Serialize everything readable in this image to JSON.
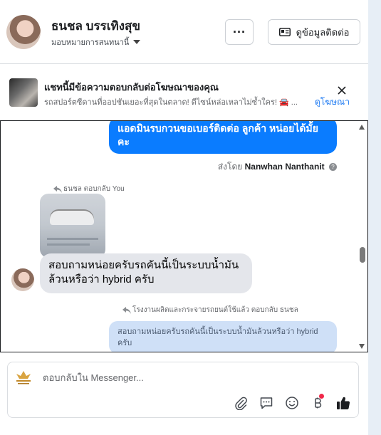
{
  "header": {
    "contact_name": "ธนชล บรรเทิงสุข",
    "assigned_label": "มอบหมายการสนทนานี้",
    "more_label": "···",
    "contact_info_label": "ดูข้อมูลติดต่อ"
  },
  "ad_banner": {
    "title": "แชทนี้มีข้อความตอบกลับต่อโฆษณาของคุณ",
    "subtitle": "รถสปอร์ตซีดานที่ออปชันเยอะที่สุดในตลาด! ดีไซน์หล่อเหลาไม่ซ้ำใคร! 🚘 ...",
    "view_ad_label": "ดูโฆษณา"
  },
  "messages": {
    "outgoing_text": "แอดมินรบกวนขอเบอร์ติดต่อ ลูกค้า  หน่อยได้มั้ยคะ",
    "sent_by_prefix": "ส่งโดย",
    "sent_by_name": "Nanwhan Nanthanit",
    "info_glyph": "?",
    "reply_label_1": "ธนชล ตอบกลับ You",
    "incoming_text": "สอบถามหน่อยครับรถคันนี้เป็นระบบน้ำมันล้วนหรือว่า hybrid ครับ",
    "reply_label_2": "โรงงานผลิตและกระจายรถยนต์ใช้แล้ว ตอบกลับ ธนชล",
    "quoted_text": "สอบถามหน่อยครับรถคันนี้เป็นระบบน้ำมันล้วนหรือว่า hybrid ครับ"
  },
  "composer": {
    "placeholder": "ตอบกลับใน Messenger..."
  },
  "colors": {
    "accent": "#0a7cff",
    "like": "#1877f2",
    "notify": "#f02849"
  },
  "icons": [
    "paperclip-icon",
    "chat-bubble-icon",
    "emoji-icon",
    "baht-icon",
    "thumbs-up-icon",
    "close-icon",
    "contact-card-icon",
    "reply-arrow-icon",
    "info-icon"
  ]
}
